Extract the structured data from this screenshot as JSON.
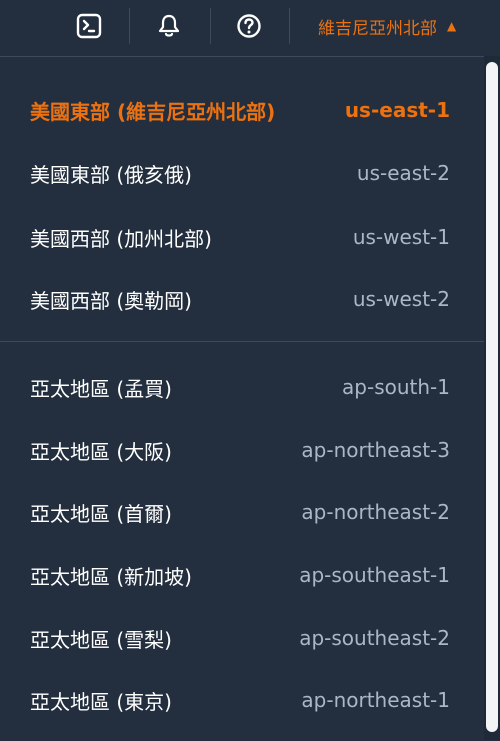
{
  "header": {
    "icons": [
      "terminal-icon",
      "bell-icon",
      "help-icon"
    ],
    "region_label": "維吉尼亞州北部",
    "caret": "▲"
  },
  "regions_us": [
    {
      "name": "美國東部 (維吉尼亞州北部)",
      "code": "us-east-1",
      "selected": true
    },
    {
      "name": "美國東部 (俄亥俄)",
      "code": "us-east-2"
    },
    {
      "name": "美國西部 (加州北部)",
      "code": "us-west-1"
    },
    {
      "name": "美國西部 (奧勒岡)",
      "code": "us-west-2"
    }
  ],
  "regions_ap": [
    {
      "name": "亞太地區 (孟買)",
      "code": "ap-south-1"
    },
    {
      "name": "亞太地區 (大阪)",
      "code": "ap-northeast-3"
    },
    {
      "name": "亞太地區 (首爾)",
      "code": "ap-northeast-2"
    },
    {
      "name": "亞太地區 (新加坡)",
      "code": "ap-southeast-1"
    },
    {
      "name": "亞太地區 (雪梨)",
      "code": "ap-southeast-2"
    },
    {
      "name": "亞太地區 (東京)",
      "code": "ap-northeast-1"
    }
  ],
  "colors": {
    "background": "#232f3e",
    "accent": "#ec7211",
    "text": "#ffffff",
    "muted": "#aab7c4"
  }
}
